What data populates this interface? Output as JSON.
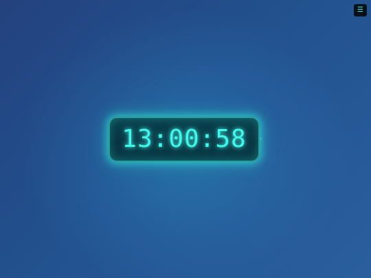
{
  "menu": {
    "icon": "menu-icon",
    "glyph": "☰"
  },
  "clock": {
    "time": "13:00:58"
  },
  "indicator": {
    "glyph": "›"
  },
  "colors": {
    "accent": "#3ff7ea",
    "panel": "#083240",
    "background_top": "#23427e",
    "background_bottom": "#2a5f9e"
  }
}
